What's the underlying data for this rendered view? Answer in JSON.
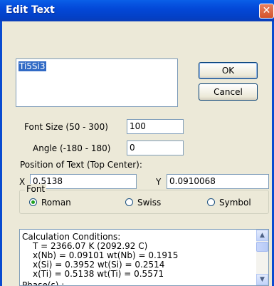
{
  "window": {
    "title": "Edit Text",
    "close_glyph": "✕"
  },
  "text_editor": {
    "value": "Ti5Si3"
  },
  "buttons": {
    "ok": "OK",
    "cancel": "Cancel"
  },
  "font_size": {
    "label": "Font Size (50 - 300)",
    "value": "100"
  },
  "angle": {
    "label": "Angle (-180 - 180)",
    "value": "0"
  },
  "position": {
    "label": "Position of Text (Top Center):",
    "x_label": "X",
    "x_value": "0.5138",
    "y_label": "Y",
    "y_value": "0.0910068"
  },
  "font": {
    "legend": "Font",
    "options": [
      "Roman",
      "Swiss",
      "Symbol"
    ],
    "selected": "Roman"
  },
  "results": {
    "lines": [
      "Calculation Conditions:",
      "T = 2366.07 K (2092.92 C)",
      "x(Nb) = 0.09101  wt(Nb) = 0.1915",
      "x(Si) = 0.3952  wt(Si) = 0.2514",
      "x(Ti) = 0.5138  wt(Ti) = 0.5571",
      "Phase(s) :"
    ]
  },
  "icons": {
    "scroll_up": "up-arrow",
    "scroll_down": "down-arrow"
  },
  "colors": {
    "titlebar": "#0348d8",
    "close": "#d3532b",
    "selection": "#316ac5",
    "dialog": "#ece9d8"
  }
}
